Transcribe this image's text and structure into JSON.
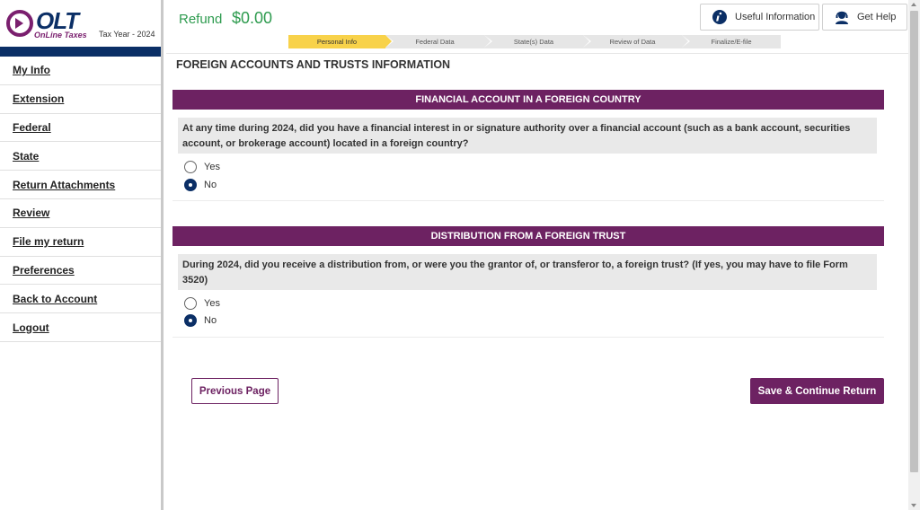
{
  "brand": {
    "logo_text": "OLT",
    "logo_sub": "OnLine Taxes",
    "tax_year": "Tax Year - 2024",
    "primary_color": "#0b2f66",
    "accent_color": "#6d2262"
  },
  "sidebar": {
    "items": [
      {
        "label": "My Info"
      },
      {
        "label": "Extension"
      },
      {
        "label": "Federal"
      },
      {
        "label": "State"
      },
      {
        "label": "Return Attachments"
      },
      {
        "label": "Review"
      },
      {
        "label": "File my return"
      },
      {
        "label": "Preferences"
      },
      {
        "label": "Back to Account"
      },
      {
        "label": "Logout"
      }
    ]
  },
  "header": {
    "refund_label": "Refund",
    "refund_value": "$0.00",
    "useful_info_label": "Useful Information",
    "get_help_label": "Get Help",
    "steps": [
      {
        "label": "Personal Info",
        "active": true
      },
      {
        "label": "Federal Data",
        "active": false
      },
      {
        "label": "State(s) Data",
        "active": false
      },
      {
        "label": "Review of Data",
        "active": false
      },
      {
        "label": "Finalize/E-file",
        "active": false
      }
    ]
  },
  "main": {
    "page_title": "FOREIGN ACCOUNTS AND TRUSTS INFORMATION",
    "sections": [
      {
        "heading": "FINANCIAL ACCOUNT IN A FOREIGN COUNTRY",
        "question": "At any time during 2024, did you have a financial interest in or signature authority over a financial account (such as a bank account, securities account, or brokerage account) located in a foreign country?",
        "options": [
          {
            "label": "Yes",
            "selected": false
          },
          {
            "label": "No",
            "selected": true
          }
        ]
      },
      {
        "heading": "DISTRIBUTION FROM A FOREIGN TRUST",
        "question": "During 2024, did you receive a distribution from, or were you the grantor of, or transferor to, a foreign trust? (If yes, you may have to file Form 3520)",
        "options": [
          {
            "label": "Yes",
            "selected": false
          },
          {
            "label": "No",
            "selected": true
          }
        ]
      }
    ],
    "prev_label": "Previous Page",
    "save_label": "Save & Continue Return"
  }
}
